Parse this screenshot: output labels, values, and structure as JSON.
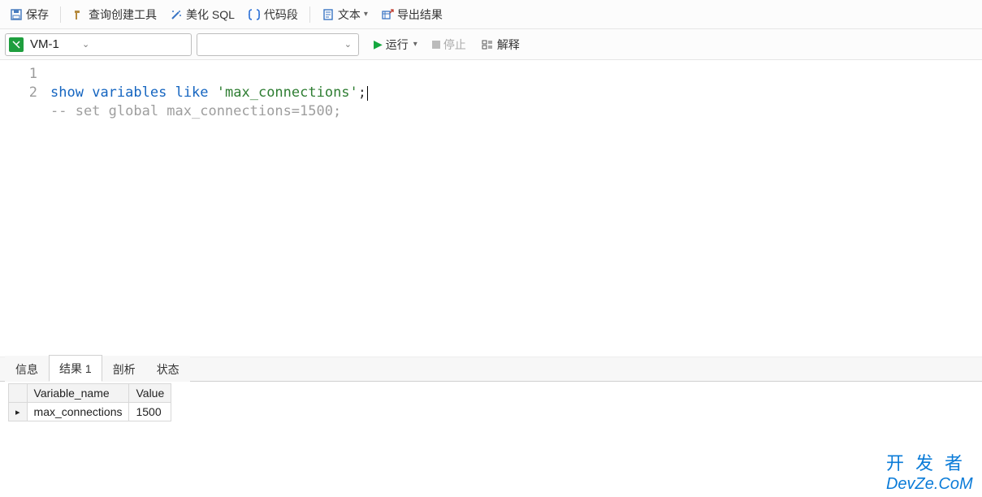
{
  "toolbar": {
    "save": "保存",
    "query_builder": "查询创建工具",
    "beautify": "美化 SQL",
    "snippet": "代码段",
    "text": "文本",
    "export": "导出结果"
  },
  "row2": {
    "connection": "VM-1",
    "schema": "",
    "run": "运行",
    "stop": "停止",
    "explain": "解释"
  },
  "editor": {
    "lines": [
      {
        "n": "1",
        "kind": "sql"
      },
      {
        "n": "2",
        "kind": "comment"
      }
    ],
    "sql_kw1": "show",
    "sql_kw2": "variables",
    "sql_kw3": "like",
    "sql_str": "'max_connections'",
    "sql_semi": ";",
    "comment": "-- set global max_connections=1500;"
  },
  "tabs": {
    "items": [
      "信息",
      "结果 1",
      "剖析",
      "状态"
    ],
    "active_index": 1
  },
  "result": {
    "columns": [
      "Variable_name",
      "Value"
    ],
    "rows": [
      {
        "marker": "▸",
        "cells": [
          "max_connections",
          "1500"
        ]
      }
    ]
  },
  "watermark": {
    "line1": "开发者",
    "line2": "DevZe.CoM"
  }
}
